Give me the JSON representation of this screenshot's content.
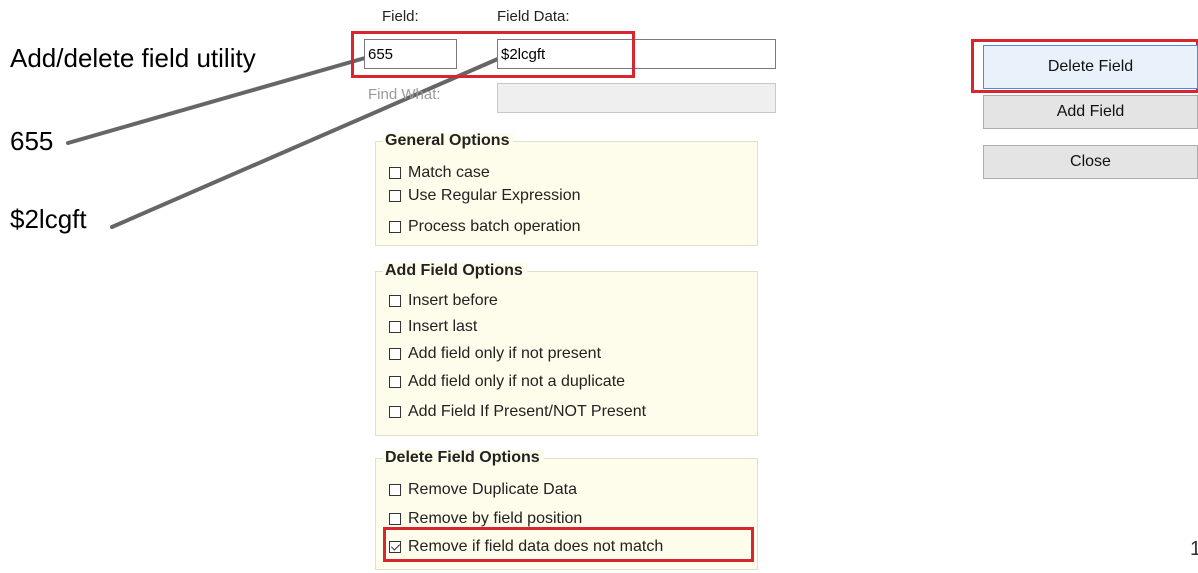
{
  "annotations": {
    "title": "Add/delete field utility",
    "field_example": "655",
    "data_example": "$2lcgft"
  },
  "form": {
    "field_label": "Field:",
    "field_value": "655",
    "field_data_label": "Field Data:",
    "field_data_value": "$2lcgft",
    "find_what_label": "Find What:",
    "find_what_value": ""
  },
  "general_options": {
    "title": "General Options",
    "items": [
      {
        "label": "Match case",
        "checked": false
      },
      {
        "label": "Use Regular Expression",
        "checked": false
      },
      {
        "label": "Process batch operation",
        "checked": false
      }
    ]
  },
  "add_field_options": {
    "title": "Add Field Options",
    "items": [
      {
        "label": "Insert before",
        "checked": false
      },
      {
        "label": "Insert last",
        "checked": false
      },
      {
        "label": "Add field only if not present",
        "checked": false
      },
      {
        "label": "Add field only if not a duplicate",
        "checked": false
      },
      {
        "label": "Add Field If Present/NOT Present",
        "checked": false
      }
    ]
  },
  "delete_field_options": {
    "title": "Delete Field Options",
    "items": [
      {
        "label": "Remove Duplicate Data",
        "checked": false
      },
      {
        "label": "Remove by field position",
        "checked": false
      },
      {
        "label": "Remove if field data does not match",
        "checked": true
      }
    ]
  },
  "buttons": {
    "delete_field": "Delete Field",
    "add_field": "Add Field",
    "close": "Close"
  },
  "page_number": "1",
  "colors": {
    "highlight": "#d8262e",
    "group_bg": "#fefcea",
    "primary_button_border": "#4d8fd6"
  }
}
